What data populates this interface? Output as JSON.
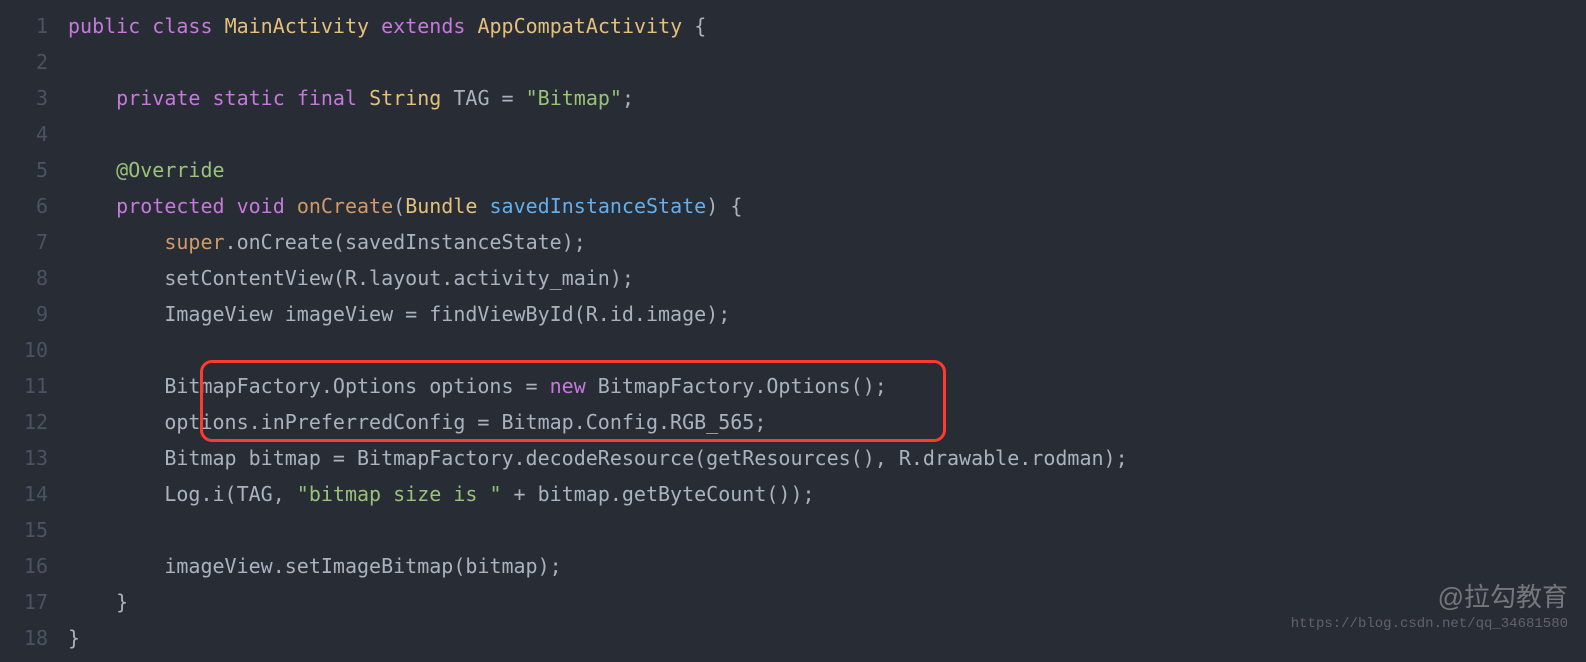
{
  "lines": [
    {
      "n": "1",
      "tokens": [
        [
          "kw",
          "public"
        ],
        [
          "pl",
          " "
        ],
        [
          "kw",
          "class"
        ],
        [
          "pl",
          " "
        ],
        [
          "cls",
          "MainActivity"
        ],
        [
          "pl",
          " "
        ],
        [
          "kw",
          "extends"
        ],
        [
          "pl",
          " "
        ],
        [
          "cls",
          "AppCompatActivity"
        ],
        [
          "pl",
          " {"
        ]
      ]
    },
    {
      "n": "2",
      "tokens": []
    },
    {
      "n": "3",
      "tokens": [
        [
          "pl",
          "    "
        ],
        [
          "kw",
          "private"
        ],
        [
          "pl",
          " "
        ],
        [
          "kw",
          "static"
        ],
        [
          "pl",
          " "
        ],
        [
          "kw",
          "final"
        ],
        [
          "pl",
          " "
        ],
        [
          "cls",
          "String"
        ],
        [
          "pl",
          " "
        ],
        [
          "pl",
          "TAG = "
        ],
        [
          "str",
          "\"Bitmap\""
        ],
        [
          "pl",
          ";"
        ]
      ]
    },
    {
      "n": "4",
      "tokens": []
    },
    {
      "n": "5",
      "tokens": [
        [
          "pl",
          "    "
        ],
        [
          "ann",
          "@Override"
        ]
      ]
    },
    {
      "n": "6",
      "tokens": [
        [
          "pl",
          "    "
        ],
        [
          "kw",
          "protected"
        ],
        [
          "pl",
          " "
        ],
        [
          "kw",
          "void"
        ],
        [
          "pl",
          " "
        ],
        [
          "fnOrange",
          "onCreate"
        ],
        [
          "pl",
          "("
        ],
        [
          "cls",
          "Bundle"
        ],
        [
          "pl",
          " "
        ],
        [
          "fn",
          "savedInstanceState"
        ],
        [
          "pl",
          ") {"
        ]
      ]
    },
    {
      "n": "7",
      "tokens": [
        [
          "pl",
          "        "
        ],
        [
          "fnOrange",
          "super"
        ],
        [
          "pl",
          ".onCreate(savedInstanceState);"
        ]
      ]
    },
    {
      "n": "8",
      "tokens": [
        [
          "pl",
          "        setContentView(R.layout.activity_main);"
        ]
      ]
    },
    {
      "n": "9",
      "tokens": [
        [
          "pl",
          "        ImageView imageView = findViewById(R.id.image);"
        ]
      ]
    },
    {
      "n": "10",
      "tokens": []
    },
    {
      "n": "11",
      "tokens": [
        [
          "pl",
          "        BitmapFactory.Options options = "
        ],
        [
          "kw",
          "new"
        ],
        [
          "pl",
          " BitmapFactory.Options();"
        ]
      ]
    },
    {
      "n": "12",
      "tokens": [
        [
          "pl",
          "        options.inPreferredConfig = Bitmap.Config.RGB_565;"
        ]
      ]
    },
    {
      "n": "13",
      "tokens": [
        [
          "pl",
          "        Bitmap bitmap = BitmapFactory.decodeResource(getResources(), R.drawable.rodman);"
        ]
      ]
    },
    {
      "n": "14",
      "tokens": [
        [
          "pl",
          "        Log.i(TAG, "
        ],
        [
          "str",
          "\"bitmap size is \""
        ],
        [
          "pl",
          " + bitmap.getByteCount());"
        ]
      ]
    },
    {
      "n": "15",
      "tokens": []
    },
    {
      "n": "16",
      "tokens": [
        [
          "pl",
          "        imageView.setImageBitmap(bitmap);"
        ]
      ]
    },
    {
      "n": "17",
      "tokens": [
        [
          "pl",
          "    }"
        ]
      ]
    },
    {
      "n": "18",
      "tokens": [
        [
          "pl",
          "}"
        ]
      ]
    }
  ],
  "highlight": {
    "startLine": 11,
    "endLine": 12
  },
  "watermark": {
    "main": "@拉勾教育",
    "sub": "https://blog.csdn.net/qq_34681580"
  }
}
